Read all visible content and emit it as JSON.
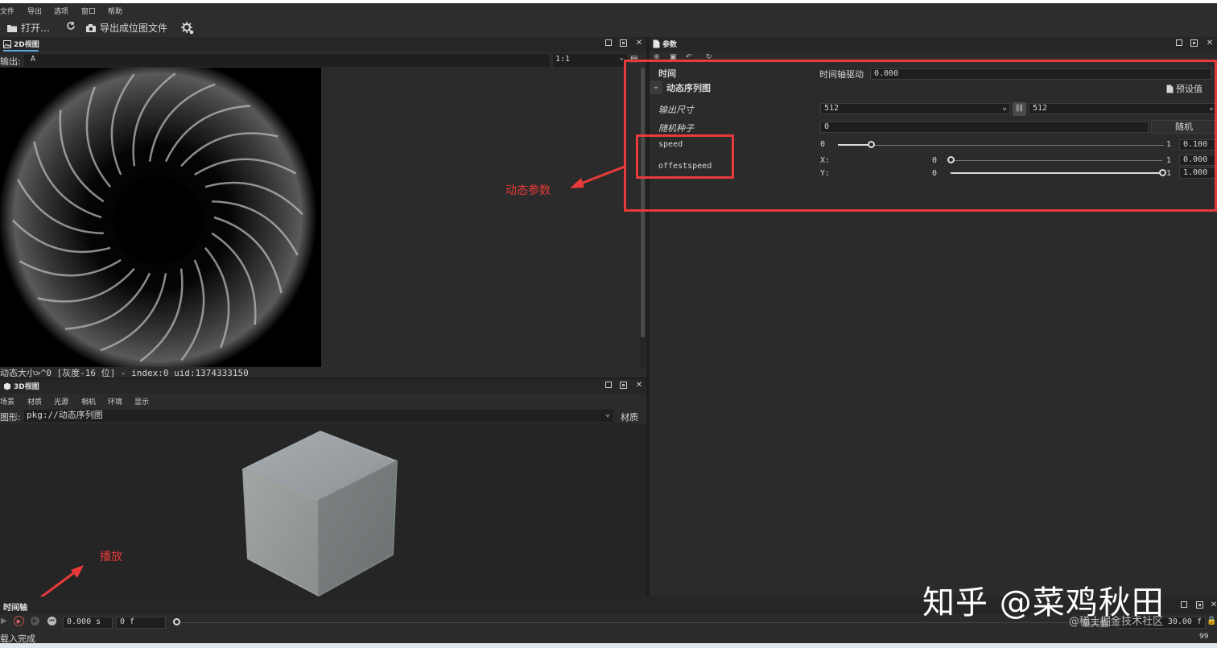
{
  "menubar": {
    "items": [
      "文件",
      "导出",
      "选项",
      "窗口",
      "帮助"
    ]
  },
  "toolbar": {
    "open_label": "打开…",
    "export_label": "导出成位图文件"
  },
  "view2d": {
    "title": "2D视图",
    "output_label": "输出:",
    "output_value": "A",
    "zoom_value": "1:1",
    "status": "动态大小>^0 [灰度-16 位] - index:0 uid:1374333150"
  },
  "view3d": {
    "title": "3D视图",
    "tabs": [
      "场景",
      "材质",
      "光源",
      "相机",
      "环境",
      "显示"
    ],
    "shape_label": "图形:",
    "shape_value": "pkg://动态序列图",
    "material_label": "材质"
  },
  "params": {
    "title": "参数",
    "time_section": "时间",
    "time_driver_label": "时间轴驱动",
    "time_driver_value": "0.000",
    "node_title": "动态序列图",
    "preset_label": "预设值",
    "output_size_label": "输出尺寸",
    "output_size_w": "512",
    "output_size_h": "512",
    "seed_label": "随机种子",
    "seed_value": "0",
    "random_button": "随机",
    "speed_label": "speed",
    "speed_min": "0",
    "speed_max": "1",
    "speed_value": "0.100",
    "speed_fraction": 0.1,
    "offset_label": "offestspeed",
    "x_label": "X:",
    "y_label": "Y:",
    "x_min": "0",
    "x_max": "1",
    "x_value": "0.000",
    "x_fraction": 0.0,
    "y_min": "0",
    "y_max": "1",
    "y_value": "1.000",
    "y_fraction": 1.0
  },
  "annotations": {
    "dynamic_params": "动态参数",
    "play": "播放"
  },
  "timeline": {
    "title": "时间轴",
    "time_value": "0.000 s",
    "frame_value": "0 f",
    "max_label": "最大值:",
    "max_value": "30.00 f"
  },
  "statusbar": {
    "text": "载入完成",
    "right": "99"
  },
  "watermark": {
    "main": "知乎 @菜鸡秋田",
    "sub": "@稀土掘金技术社区"
  },
  "colors": {
    "annotation": "#e83a3a",
    "accent": "#5aa7e0",
    "background": "#2b2b2b"
  }
}
